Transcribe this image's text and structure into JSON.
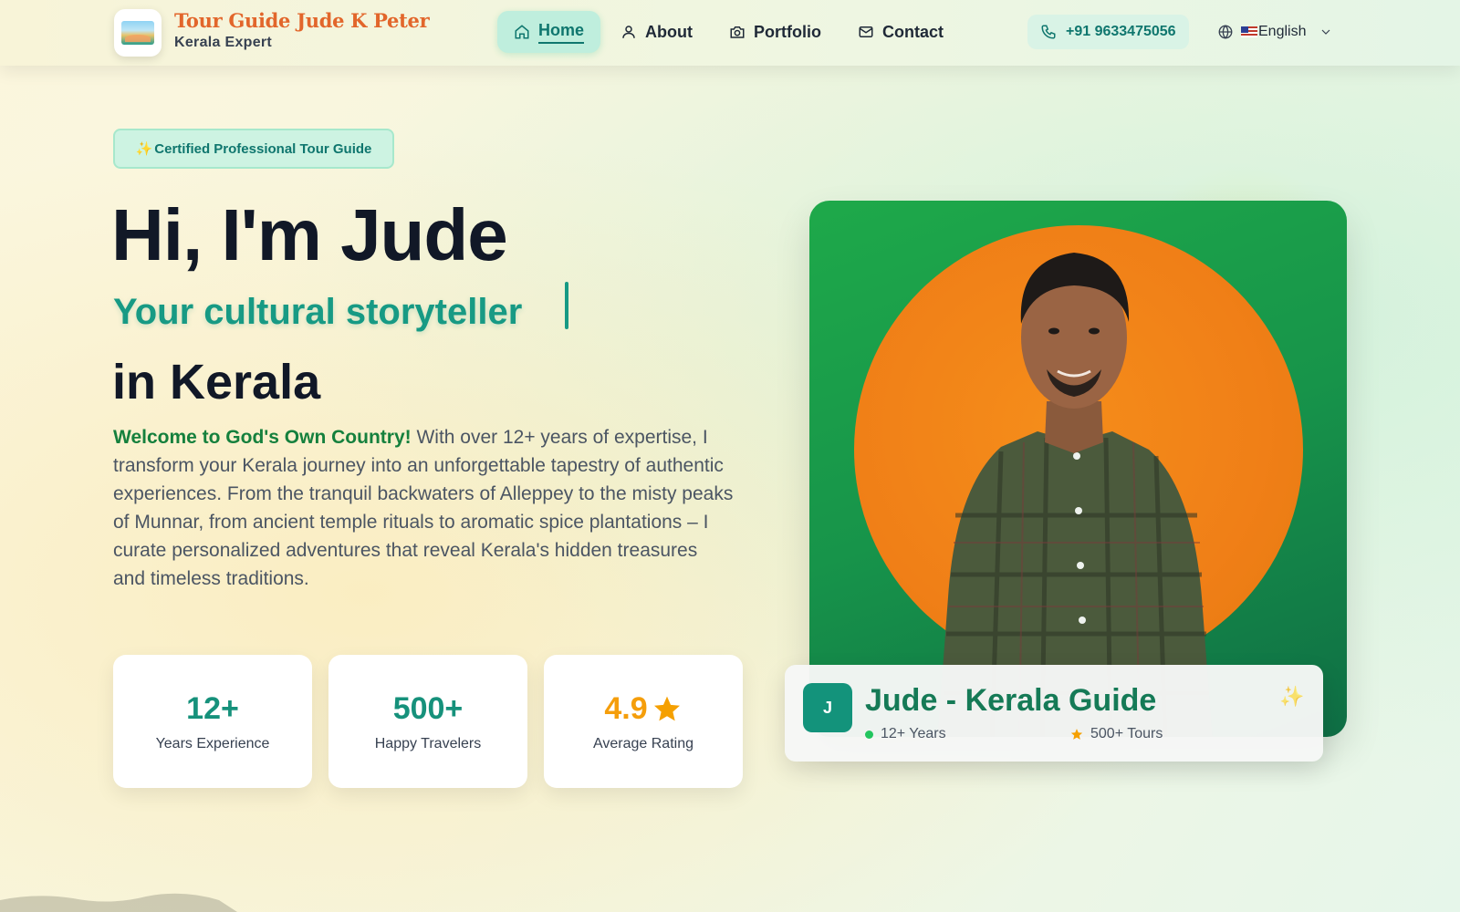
{
  "header": {
    "brand_title": "Tour Guide Jude K Peter",
    "brand_subtitle": "Kerala Expert",
    "nav": [
      {
        "label": "Home",
        "icon": "home-icon",
        "active": true
      },
      {
        "label": "About",
        "icon": "user-icon",
        "active": false
      },
      {
        "label": "Portfolio",
        "icon": "camera-icon",
        "active": false
      },
      {
        "label": "Contact",
        "icon": "mail-icon",
        "active": false
      }
    ],
    "phone": "+91 9633475056",
    "language": "English"
  },
  "hero": {
    "badge": "Certified Professional Tour Guide",
    "greeting": "Hi, I'm Jude",
    "tagline": "Your cultural storyteller",
    "location_line": "in Kerala",
    "welcome": "Welcome to God's Own Country!",
    "intro": " With over 12+ years of expertise, I transform your Kerala journey into an unforgettable tapestry of authentic experiences. From the tranquil backwaters of Alleppey to the misty peaks of Munnar, from ancient temple rituals to aromatic spice plantations – I curate personalized adventures that reveal Kerala's hidden treasures and timeless traditions."
  },
  "stats": [
    {
      "value": "12+",
      "label": "Years Experience"
    },
    {
      "value": "500+",
      "label": "Happy Travelers"
    },
    {
      "value": "4.9",
      "label": "Average Rating"
    }
  ],
  "profile_card": {
    "avatar_letter": "J",
    "title": "Jude - Kerala Guide",
    "years": "12+ Years",
    "tours": "500+ Tours"
  },
  "colors": {
    "accent": "#179a84",
    "brand_orange": "#e2662b",
    "photo_green": "#17944a",
    "sun_orange": "#f58d1a"
  }
}
